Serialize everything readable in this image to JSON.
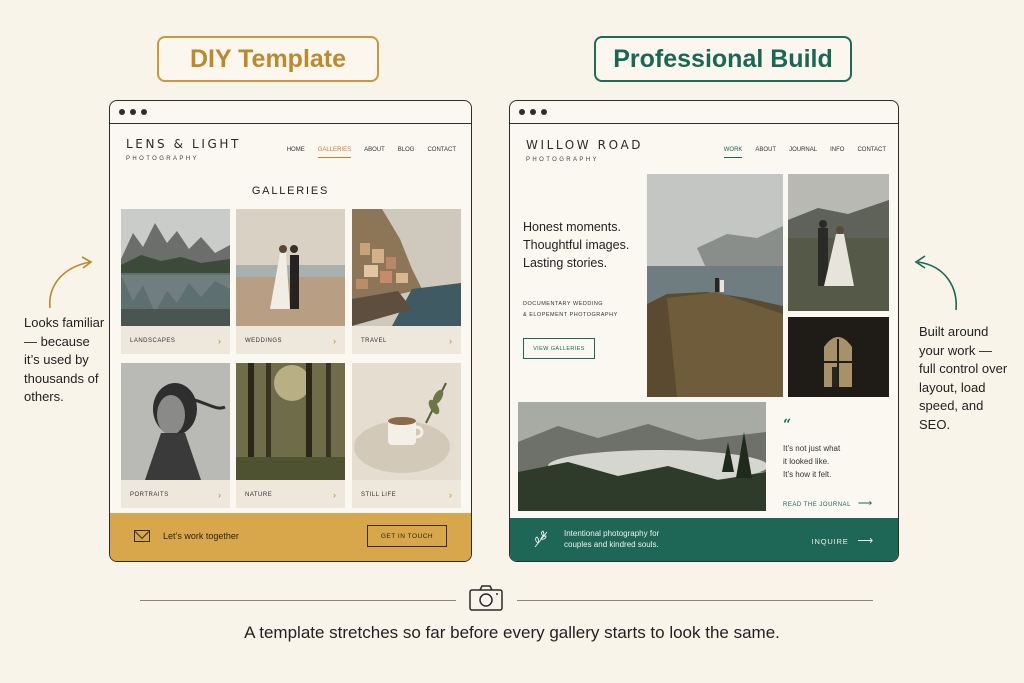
{
  "labels": {
    "diy": "DIY Template",
    "pro": "Professional Build"
  },
  "diy": {
    "brand": "LENS & LIGHT",
    "brand_sub": "PHOTOGRAPHY",
    "nav": [
      "HOME",
      "GALLERIES",
      "ABOUT",
      "BLOG",
      "CONTACT"
    ],
    "active_nav": "GALLERIES",
    "gallery_title": "GALLERIES",
    "cards": [
      "LANDSCAPES",
      "WEDDINGS",
      "TRAVEL",
      "PORTRAITS",
      "NATURE",
      "STILL LIFE"
    ],
    "footer_text": "Let’s work together",
    "footer_button": "GET IN TOUCH"
  },
  "pro": {
    "brand": "WILLOW ROAD",
    "brand_sub": "PHOTOGRAPHY",
    "nav": [
      "WORK",
      "ABOUT",
      "JOURNAL",
      "INFO",
      "CONTACT"
    ],
    "active_nav": "WORK",
    "hero": [
      "Honest moments.",
      "Thoughtful images.",
      "Lasting stories."
    ],
    "subtitle": [
      "DOCUMENTARY WEDDING",
      "& ELOPEMENT PHOTOGRAPHY"
    ],
    "cta": "VIEW GALLERIES",
    "quote": [
      "It’s not just what",
      "it looked like.",
      "It’s how it felt."
    ],
    "journal_link": "READ THE JOURNAL",
    "footer_text": [
      "Intentional photography for",
      "couples and kindred souls."
    ],
    "inquire": "INQUIRE"
  },
  "side_left": "Looks familiar — because it’s used by thousands of others.",
  "side_right": "Built around your work — full control over layout, load speed, and SEO.",
  "caption": "A template stretches so far before every gallery starts to look the same.",
  "colors": {
    "gold": "#d8a64b",
    "green": "#1e6656",
    "background": "#f8f4ea"
  }
}
